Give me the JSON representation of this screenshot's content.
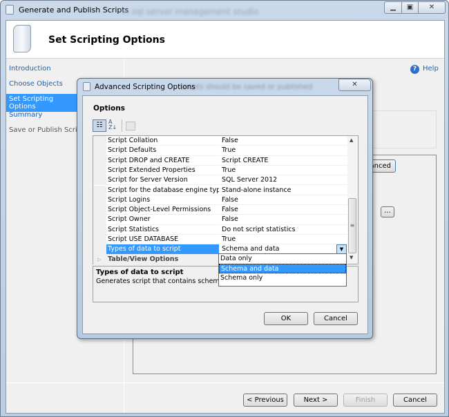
{
  "window": {
    "title": "Generate and Publish Scripts",
    "background_text": "in sql server management studio"
  },
  "header": {
    "title": "Set Scripting Options"
  },
  "nav": {
    "items": [
      {
        "label": "Introduction",
        "state": "link"
      },
      {
        "label": "Choose Objects",
        "state": "link"
      },
      {
        "label": "Set Scripting Options",
        "state": "selected"
      },
      {
        "label": "Summary",
        "state": "link"
      },
      {
        "label": "Save or Publish Scripts",
        "state": "disabled"
      }
    ]
  },
  "help": {
    "label": "Help",
    "icon": "help-icon"
  },
  "main": {
    "advanced_label": "Advanced",
    "browse_label": "...",
    "blurred_text": "scripts should be saved or published"
  },
  "footer": {
    "previous": "< Previous",
    "next": "Next >",
    "finish": "Finish",
    "cancel": "Cancel"
  },
  "dialog": {
    "title": "Advanced Scripting Options",
    "close": "✕",
    "options_label": "Options",
    "properties": [
      {
        "name": "Script Collation",
        "value": "False"
      },
      {
        "name": "Script Defaults",
        "value": "True"
      },
      {
        "name": "Script DROP and CREATE",
        "value": "Script CREATE"
      },
      {
        "name": "Script Extended Properties",
        "value": "True"
      },
      {
        "name": "Script for Server Version",
        "value": "SQL Server 2012"
      },
      {
        "name": "Script for the database engine type",
        "value": "Stand-alone instance"
      },
      {
        "name": "Script Logins",
        "value": "False"
      },
      {
        "name": "Script Object-Level Permissions",
        "value": "False"
      },
      {
        "name": "Script Owner",
        "value": "False"
      },
      {
        "name": "Script Statistics",
        "value": "Do not script statistics"
      },
      {
        "name": "Script USE DATABASE",
        "value": "True"
      },
      {
        "name": "Types of data to script",
        "value": "Schema and data"
      }
    ],
    "category": "Table/View Options",
    "dropdown_options": [
      "Data only",
      "Schema and data",
      "Schema only"
    ],
    "dropdown_selected": "Schema and data",
    "description_title": "Types of data to script",
    "description_text": "Generates script that contains schema only",
    "ok": "OK",
    "cancel": "Cancel",
    "selection_color": "#3399ff"
  }
}
